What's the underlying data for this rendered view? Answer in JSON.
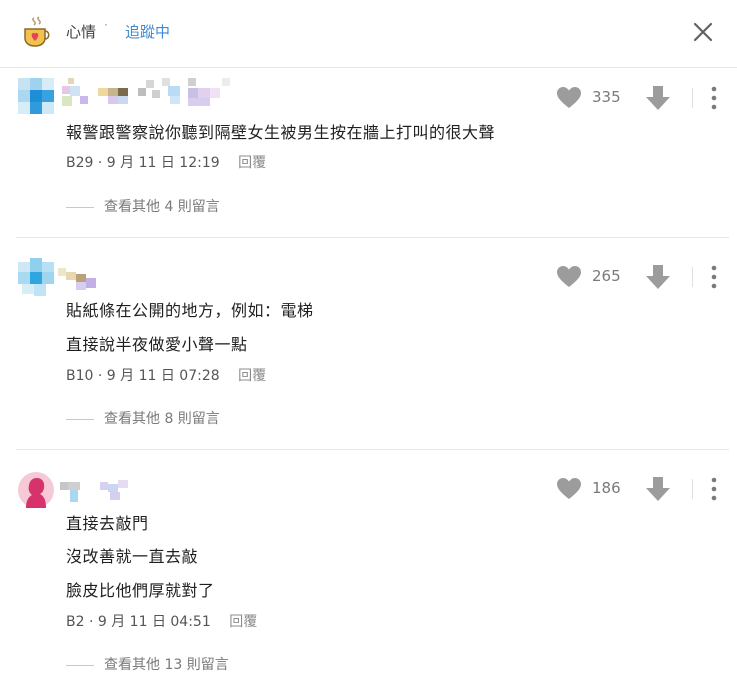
{
  "header": {
    "forum_name": "心情",
    "separator": "·",
    "follow_label": "追蹤中"
  },
  "icons": {
    "logo": "coffee-cup-heart-icon",
    "close": "close-icon",
    "like": "heart-icon",
    "dislike": "arrow-down-icon",
    "more": "more-vertical-icon"
  },
  "colors": {
    "accent": "#3d8bd6",
    "icon_gray": "#9c9c9c",
    "avatar_pink": "#d6336c"
  },
  "comments": [
    {
      "floor": "B29",
      "date": "9 月 11 日 12:19",
      "reply_label": "回覆",
      "lines": [
        "報警跟警察說你聽到隔壁女生被男生按在牆上打叫的很大聲"
      ],
      "likes": "335",
      "more_replies": "查看其他 4 則留言"
    },
    {
      "floor": "B10",
      "date": "9 月 11 日 07:28",
      "reply_label": "回覆",
      "lines": [
        "貼紙條在公開的地方，例如：電梯",
        "直接說半夜做愛小聲一點"
      ],
      "likes": "265",
      "more_replies": "查看其他 8 則留言"
    },
    {
      "floor": "B2",
      "date": "9 月 11 日 04:51",
      "reply_label": "回覆",
      "lines": [
        "直接去敲門",
        "沒改善就一直去敲",
        "臉皮比他們厚就對了"
      ],
      "likes": "186",
      "more_replies": "查看其他 13 則留言"
    }
  ]
}
